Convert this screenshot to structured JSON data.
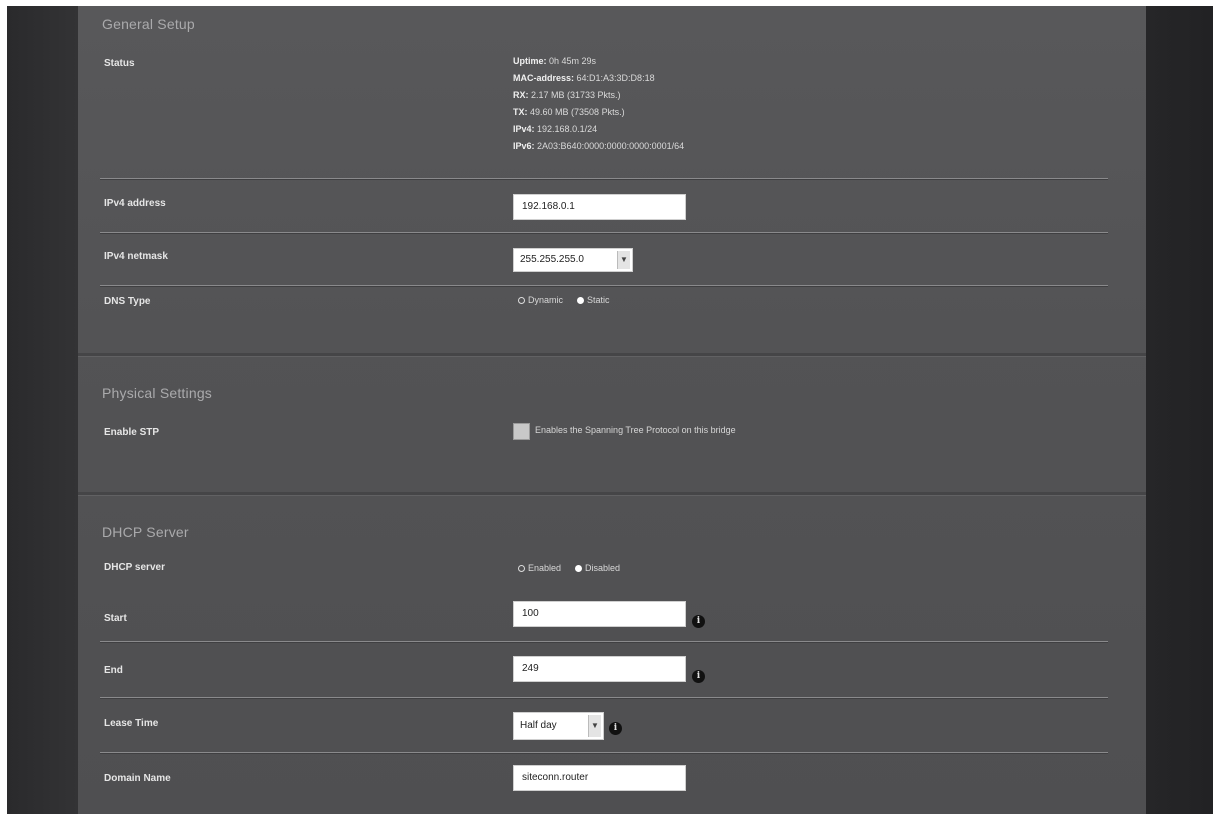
{
  "general_setup": {
    "title": "General Setup",
    "status": {
      "label": "Status",
      "lines": [
        {
          "key": "Uptime:",
          "value": "0h 45m 29s"
        },
        {
          "key": "MAC-address:",
          "value": "64:D1:A3:3D:D8:18"
        },
        {
          "key": "RX:",
          "value": "2.17 MB (31733 Pkts.)"
        },
        {
          "key": "TX:",
          "value": "49.60 MB (73508 Pkts.)"
        },
        {
          "key": "IPv4:",
          "value": "192.168.0.1/24"
        },
        {
          "key": "IPv6:",
          "value": "2A03:B640:0000:0000:0000:0001/64"
        }
      ]
    },
    "ipv4_address": {
      "label": "IPv4 address",
      "value": "192.168.0.1"
    },
    "ipv4_netmask": {
      "label": "IPv4 netmask",
      "value": "255.255.255.0"
    },
    "dns_type": {
      "label": "DNS Type",
      "options": [
        "Dynamic",
        "Static"
      ],
      "selected": "Static"
    }
  },
  "physical_settings": {
    "title": "Physical Settings",
    "enable_stp": {
      "label": "Enable STP",
      "description": "Enables the Spanning Tree Protocol on this bridge",
      "checked": false
    }
  },
  "dhcp_server": {
    "title": "DHCP Server",
    "dhcp_server": {
      "label": "DHCP server",
      "options": [
        "Enabled",
        "Disabled"
      ],
      "selected": "Disabled"
    },
    "start": {
      "label": "Start",
      "value": "100"
    },
    "end": {
      "label": "End",
      "value": "249"
    },
    "lease_time": {
      "label": "Lease Time",
      "value": "Half day"
    },
    "domain_name": {
      "label": "Domain Name",
      "value": "siteconn.router"
    }
  },
  "icons": {
    "info": "info-icon",
    "dropdown": "chevron-down-icon"
  }
}
